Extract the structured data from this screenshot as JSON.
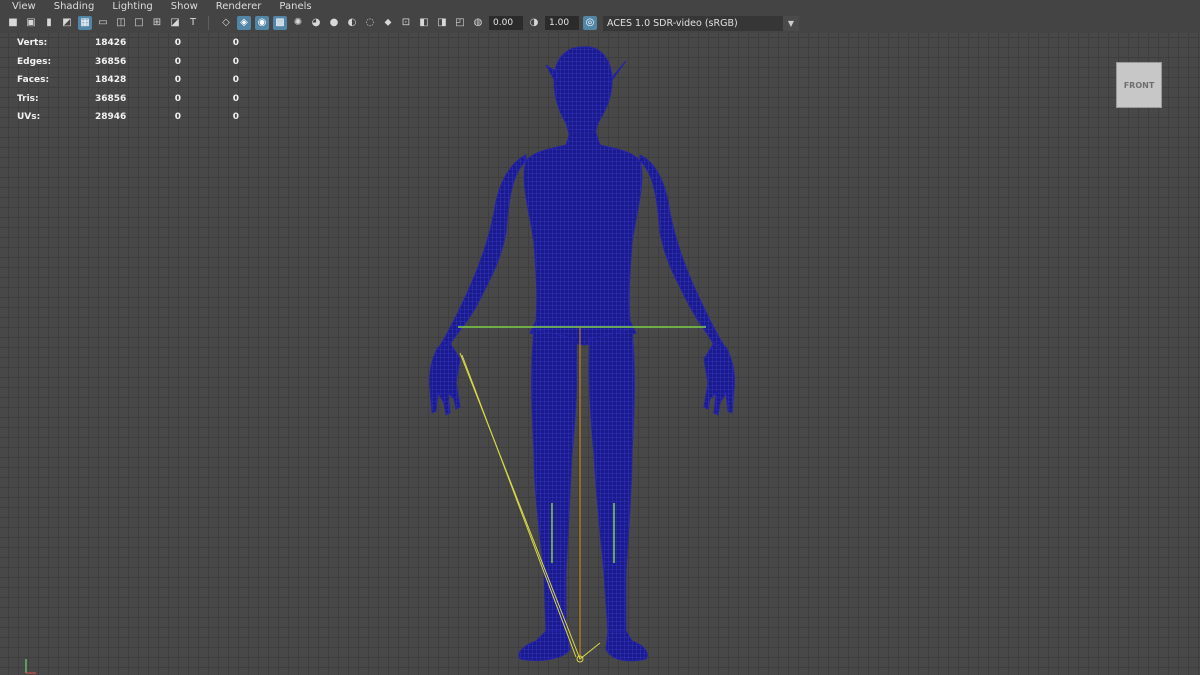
{
  "menubar": {
    "items": [
      "View",
      "Shading",
      "Lighting",
      "Show",
      "Renderer",
      "Panels"
    ]
  },
  "toolbar": {
    "icons_group1": [
      "camera-icon",
      "camera-attributes-icon",
      "bookmark-icon",
      "image-plane-icon",
      "grid-icon",
      "film-gate-icon",
      "resolution-gate-icon",
      "gate-mask-icon",
      "field-chart-icon",
      "safe-action-icon",
      "safe-title-icon"
    ],
    "icons_group2": [
      "wireframe-icon",
      "smooth-shade-icon",
      "default-material-icon",
      "textured-icon",
      "lights-icon",
      "shadows-icon",
      "ambient-occlusion-icon",
      "motion-blur-icon",
      "anti-aliasing-icon",
      "depth-of-field-icon",
      "isolate-select-icon",
      "xray-icon",
      "xray-joints-icon",
      "backface-culling-icon",
      "exposure-icon"
    ],
    "exposure_value": "0.00",
    "gamma_value": "1.00",
    "colorspace_label": "ACES 1.0 SDR-video (sRGB)"
  },
  "hud": {
    "rows": [
      {
        "label": "Verts:",
        "value": "18426",
        "sel": "0",
        "comp": "0"
      },
      {
        "label": "Edges:",
        "value": "36856",
        "sel": "0",
        "comp": "0"
      },
      {
        "label": "Faces:",
        "value": "18428",
        "sel": "0",
        "comp": "0"
      },
      {
        "label": "Tris:",
        "value": "36856",
        "sel": "0",
        "comp": "0"
      },
      {
        "label": "UVs:",
        "value": "28946",
        "sel": "0",
        "comp": "0"
      }
    ]
  },
  "viewcube": {
    "label": "FRONT"
  },
  "colors": {
    "mesh": "#1b1a8a",
    "mesh_line": "#3a3ad6",
    "joint_yellow": "#d8d84a",
    "joint_green": "#7ed04a",
    "joint_orange": "#d98a1e"
  }
}
